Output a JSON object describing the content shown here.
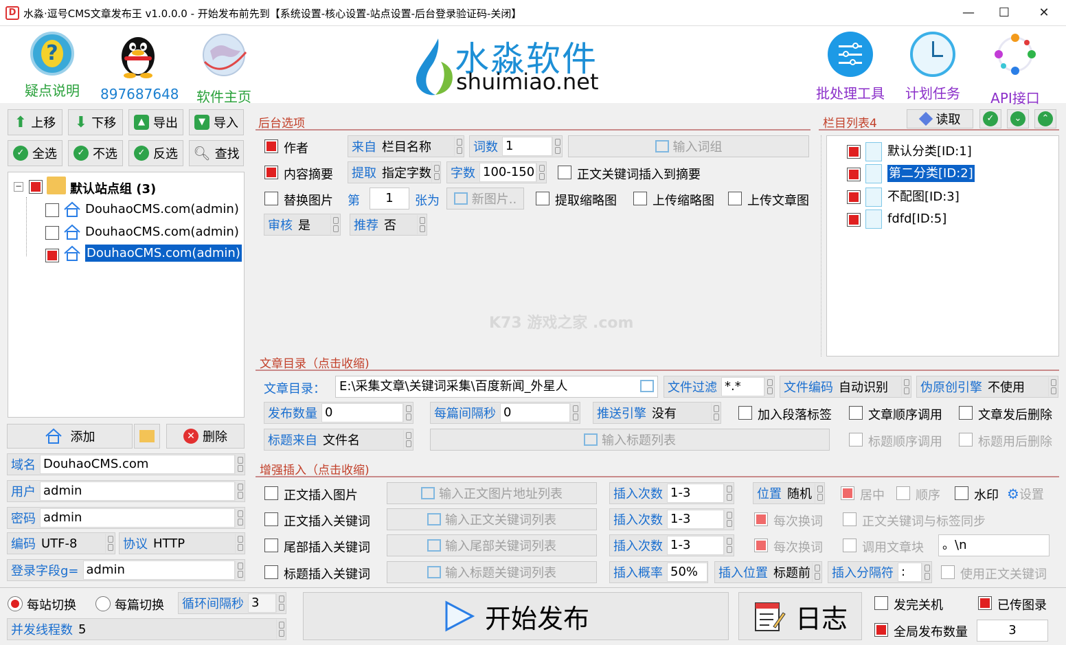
{
  "window": {
    "title": "水淼·逗号CMS文章发布王 v1.0.0.0 - 开始发布前先到【系统设置-核心设置-站点设置-后台登录验证码-关闭】",
    "app_icon": "D",
    "controls": {
      "minimize": "—",
      "maximize": "☐",
      "close": "✕"
    }
  },
  "toolbar": {
    "help_label": "疑点说明",
    "qq_label": "897687648",
    "home_label": "软件主页",
    "logo_cn": "水淼软件",
    "logo_en": "shuimiao.net",
    "batch_label": "批处理工具",
    "plan_label": "计划任务",
    "api_label": "API接口",
    "help_glyph": "?",
    "colors": {
      "blue": "#1a7fd0",
      "purple": "#8b2fc9",
      "green": "#2aa13b"
    }
  },
  "sites": {
    "buttons": {
      "up": "上移",
      "down": "下移",
      "export": "导出",
      "import": "导入",
      "select_all": "全选",
      "select_none": "不选",
      "invert": "反选",
      "find": "查找"
    },
    "group_label": "默认站点组 (3)",
    "tree_toggle": "−",
    "items": [
      "DouhaoCMS.com(admin)",
      "DouhaoCMS.com(admin)",
      "DouhaoCMS.com(admin)"
    ],
    "add": "添加",
    "delete": "删除",
    "domain_label": "域名",
    "domain_value": "DouhaoCMS.com",
    "user_label": "用户",
    "user_value": "admin",
    "pass_label": "密码",
    "pass_value": "admin",
    "enc_label": "编码",
    "enc_value": "UTF-8",
    "proto_label": "协议",
    "proto_value": "HTTP",
    "login_label": "登录字段g=",
    "login_value": "admin"
  },
  "backend": {
    "title": "后台选项",
    "author": "作者",
    "from_label": "来自",
    "from_value": "栏目名称",
    "words_label": "词数",
    "words_value": "1",
    "input_wordgroup": "输入词组",
    "summary": "内容摘要",
    "extract_label": "提取",
    "extract_value": "指定字数",
    "chars_label": "字数",
    "chars_value": "100-150",
    "kw_in_summary": "正文关键词插入到摘要",
    "replace_img": "替换图片",
    "nth": "第",
    "nth_value": "1",
    "sheet_as": "张为",
    "new_img": "新图片..",
    "extract_thumb": "提取缩略图",
    "upload_thumb": "上传缩略图",
    "upload_img": "上传文章图",
    "audit_label": "审核",
    "audit_value": "是",
    "recommend_label": "推荐",
    "recommend_value": "否",
    "watermark": "K73 游戏之家 .com"
  },
  "columns": {
    "title": "栏目列表4",
    "read": "读取",
    "items": [
      "默认分类[ID:1]",
      "第二分类[ID:2]",
      "不配图[ID:3]",
      "fdfd[ID:5]"
    ]
  },
  "article_dir": {
    "title": "文章目录（点击收缩)",
    "dir_label": "文章目录：",
    "dir_value": "E:\\采集文章\\关键词采集\\百度新闻_外星人",
    "filter_label": "文件过滤",
    "filter_value": "*.*",
    "enc_label": "文件编码",
    "enc_value": "自动识别",
    "pseudo_label": "伪原创引擎",
    "pseudo_value": "不使用",
    "count_label": "发布数量",
    "count_value": "0",
    "interval_label": "每篇间隔秒",
    "interval_value": "0",
    "push_label": "推送引擎",
    "push_value": "没有",
    "para_tag": "加入段落标签",
    "order_call": "文章顺序调用",
    "del_after": "文章发后删除",
    "title_from_label": "标题来自",
    "title_from_value": "文件名",
    "input_title_list": "输入标题列表",
    "title_order": "标题顺序调用",
    "title_del": "标题用后删除"
  },
  "enhance": {
    "title": "增强插入（点击收缩)",
    "row1": {
      "chk": "正文插入图片",
      "btn": "输入正文图片地址列表",
      "times_label": "插入次数",
      "times_value": "1-3",
      "pos_label": "位置",
      "pos_value": "随机",
      "center": "居中",
      "order": "顺序",
      "watermark": "水印",
      "settings": "设置"
    },
    "row2": {
      "chk": "正文插入关键词",
      "btn": "输入正文关键词列表",
      "times_label": "插入次数",
      "times_value": "1-3",
      "each": "每次换词",
      "sync": "正文关键词与标签同步"
    },
    "row3": {
      "chk": "尾部插入关键词",
      "btn": "输入尾部关键词列表",
      "times_label": "插入次数",
      "times_value": "1-3",
      "each": "每次换词",
      "call_block": "调用文章块",
      "sep_value": "。\\n"
    },
    "row4": {
      "chk": "标题插入关键词",
      "btn": "输入标题关键词列表",
      "prob_label": "插入概率",
      "prob_value": "50%",
      "pos_label": "插入位置",
      "pos_value": "标题前",
      "sep_label": "插入分隔符",
      "sep_value": ":",
      "use_body": "使用正文关键词"
    }
  },
  "bottom": {
    "per_site": "每站切换",
    "per_article": "每篇切换",
    "loop_label": "循环间隔秒",
    "loop_value": "3",
    "threads_label": "并发线程数",
    "threads_value": "5",
    "start": "开始发布",
    "log": "日志",
    "shutdown": "发完关机",
    "uploaded": "已传图录",
    "global_count": "全局发布数量",
    "global_value": "3"
  }
}
